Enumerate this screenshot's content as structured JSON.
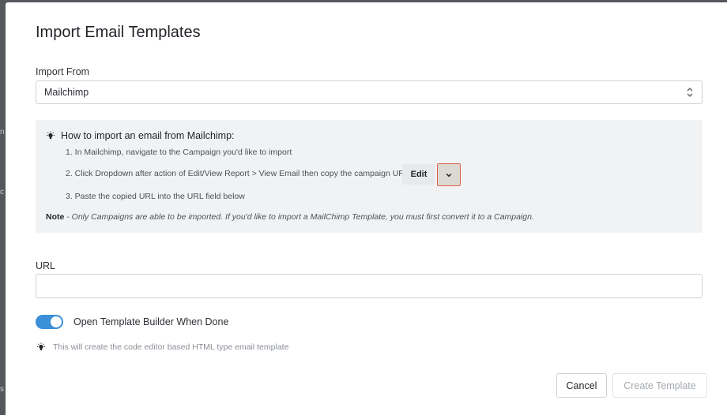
{
  "modal": {
    "title": "Import Email Templates"
  },
  "import_from": {
    "label": "Import From",
    "value": "Mailchimp"
  },
  "help": {
    "title": "How to import an email from Mailchimp:",
    "steps": [
      "1. In Mailchimp, navigate to the Campaign you'd like to import",
      "2. Click Dropdown after action of Edit/View Report > View Email then copy the campaign URL",
      "3. Paste the copied URL into the URL field below"
    ],
    "edit_button_label": "Edit",
    "note_label": "Note",
    "note_text": " - Only Campaigns are able to be imported. If you'd like to import a MailChimp Template, you must first convert it to a Campaign."
  },
  "url": {
    "label": "URL",
    "value": "",
    "placeholder": ""
  },
  "toggle": {
    "label": "Open Template Builder When Done",
    "checked": true
  },
  "hint": {
    "text": "This will create the code editor based HTML type email template"
  },
  "footer": {
    "cancel_label": "Cancel",
    "create_label": "Create Template"
  },
  "colors": {
    "accent": "#3b8fd6",
    "highlight_border": "#e0604a"
  },
  "icons": {
    "help_title_icon": "lightbulb-icon",
    "dropdown_icon": "chevron-down-icon",
    "select_icon": "chevron-up-down-icon",
    "hint_icon": "lightbulb-icon"
  }
}
